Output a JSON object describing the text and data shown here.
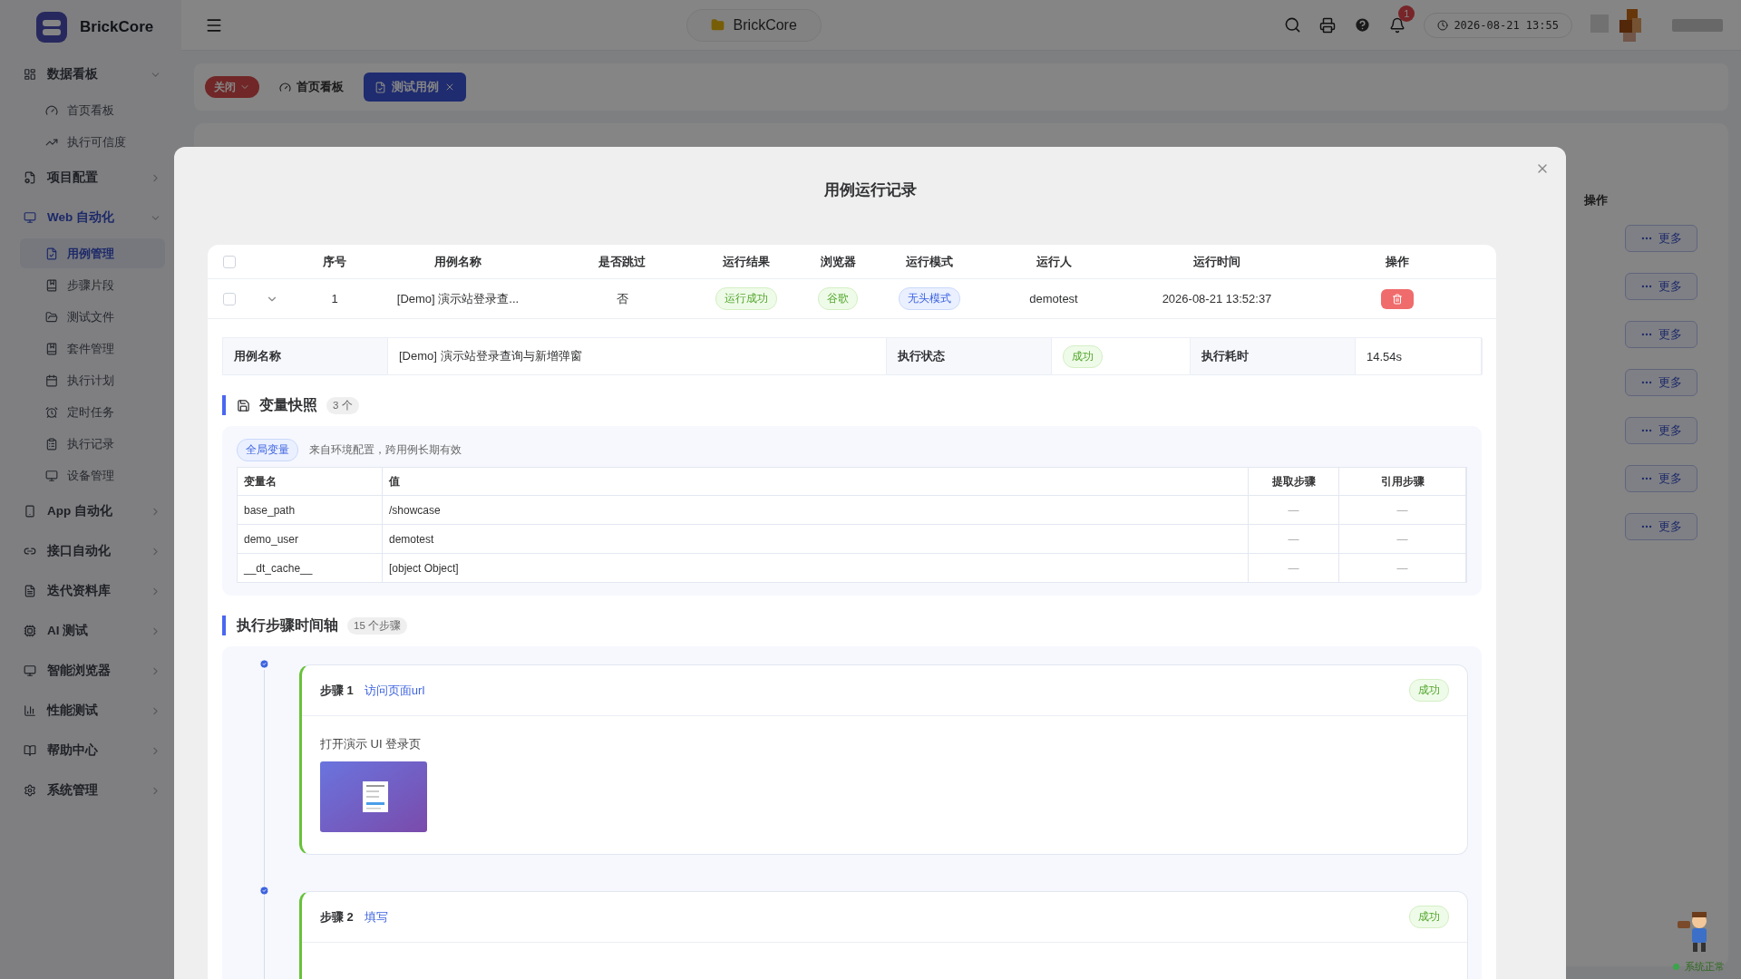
{
  "app": {
    "name": "BrickCore"
  },
  "header": {
    "project": "BrickCore",
    "notifications": "1",
    "time": "2026-08-21 13:55"
  },
  "sidebar": {
    "groups": [
      {
        "label": "数据看板",
        "selected": false,
        "expanded": true,
        "children": [
          {
            "label": "首页看板",
            "selected": false
          },
          {
            "label": "执行可信度",
            "selected": false
          }
        ]
      },
      {
        "label": "项目配置",
        "selected": false,
        "expanded": false
      },
      {
        "label": "Web 自动化",
        "selected": true,
        "expanded": true,
        "children": [
          {
            "label": "用例管理",
            "selected": true
          },
          {
            "label": "步骤片段",
            "selected": false
          },
          {
            "label": "测试文件",
            "selected": false
          },
          {
            "label": "套件管理",
            "selected": false
          },
          {
            "label": "执行计划",
            "selected": false
          },
          {
            "label": "定时任务",
            "selected": false
          },
          {
            "label": "执行记录",
            "selected": false
          },
          {
            "label": "设备管理",
            "selected": false
          }
        ]
      },
      {
        "label": "App 自动化",
        "selected": false,
        "expanded": false
      },
      {
        "label": "接口自动化",
        "selected": false,
        "expanded": false
      },
      {
        "label": "迭代资料库",
        "selected": false,
        "expanded": false
      },
      {
        "label": "AI 测试",
        "selected": false,
        "expanded": false
      },
      {
        "label": "智能浏览器",
        "selected": false,
        "expanded": false
      },
      {
        "label": "性能测试",
        "selected": false,
        "expanded": false
      },
      {
        "label": "帮助中心",
        "selected": false,
        "expanded": false
      },
      {
        "label": "系统管理",
        "selected": false,
        "expanded": false
      }
    ]
  },
  "tab_bar": {
    "close_menu": "关闭",
    "tabs": [
      {
        "label": "首页看板",
        "selected": false,
        "closable": false
      },
      {
        "label": "测试用例",
        "selected": true,
        "closable": true
      }
    ]
  },
  "background_table": {
    "action_header": "操作",
    "more_buttons": [
      "更多",
      "更多",
      "更多",
      "更多",
      "更多",
      "更多",
      "更多"
    ]
  },
  "modal": {
    "title": "用例运行记录",
    "table": {
      "all_checked": false,
      "columns": [
        "序号",
        "用例名称",
        "是否跳过",
        "运行结果",
        "浏览器",
        "运行模式",
        "运行人",
        "运行时间",
        "操作"
      ],
      "rows": [
        {
          "checked": false,
          "expanded": true,
          "index": "1",
          "name": "[Demo] 演示站登录查...",
          "skipped": "否",
          "result": "运行成功",
          "browser": "谷歌",
          "mode": "无头模式",
          "runner": "demotest",
          "time": "2026-08-21 13:52:37"
        }
      ]
    },
    "details": [
      {
        "label": "用例名称",
        "value": "[Demo] 演示站登录查询与新增弹窗",
        "kind": "text"
      },
      {
        "label": "执行状态",
        "value": "成功",
        "kind": "tag"
      },
      {
        "label": "执行耗时",
        "value": "14.54s",
        "kind": "text"
      }
    ],
    "variables": {
      "title": "变量快照",
      "count": "3 个",
      "scope_tag": "全局变量",
      "scope_note": "来自环境配置，跨用例长期有效",
      "columns": [
        "变量名",
        "值",
        "提取步骤",
        "引用步骤"
      ],
      "rows": [
        [
          "base_path",
          "/showcase",
          "—",
          "—"
        ],
        [
          "demo_user",
          "demotest",
          "—",
          "—"
        ],
        [
          "__dt_cache__",
          "[object Object]",
          "—",
          "—"
        ]
      ]
    },
    "timeline": {
      "title": "执行步骤时间轴",
      "count": "15 个步骤",
      "steps": [
        {
          "label": "步骤 1",
          "action": "访问页面url",
          "status": "成功",
          "description": "打开演示 UI 登录页",
          "has_screenshot": true
        },
        {
          "label": "步骤 2",
          "action": "填写",
          "status": "成功",
          "has_screenshot": false
        }
      ]
    }
  },
  "status": {
    "text": "系统正常"
  }
}
